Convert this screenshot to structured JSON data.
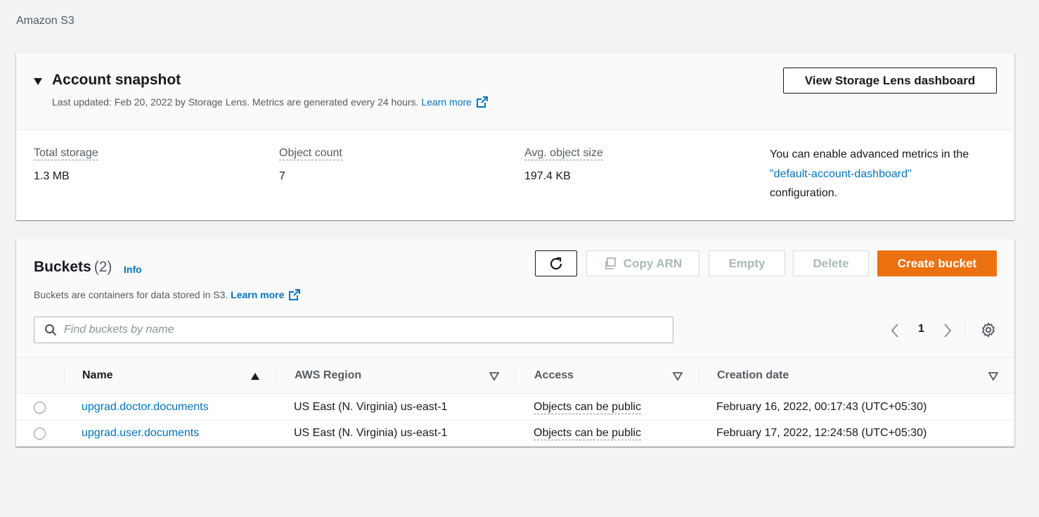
{
  "breadcrumb": "Amazon S3",
  "snapshot": {
    "title": "Account snapshot",
    "subtitle": "Last updated: Feb 20, 2022 by Storage Lens. Metrics are generated every 24 hours.",
    "learn_more": "Learn more",
    "view_button": "View Storage Lens dashboard",
    "metrics": [
      {
        "label": "Total storage",
        "value": "1.3 MB"
      },
      {
        "label": "Object count",
        "value": "7"
      },
      {
        "label": "Avg. object size",
        "value": "197.4 KB"
      }
    ],
    "advanced_text_1": "You can enable advanced metrics in the",
    "advanced_link": "\"default-account-dashboard\"",
    "advanced_text_2": "configuration."
  },
  "buckets": {
    "title": "Buckets",
    "count": "(2)",
    "info": "Info",
    "subtitle": "Buckets are containers for data stored in S3.",
    "learn_more": "Learn more",
    "buttons": {
      "copy_arn": "Copy ARN",
      "empty": "Empty",
      "delete": "Delete",
      "create": "Create bucket"
    },
    "search_placeholder": "Find buckets by name",
    "page": "1",
    "columns": [
      "Name",
      "AWS Region",
      "Access",
      "Creation date"
    ],
    "rows": [
      {
        "name": "upgrad.doctor.documents",
        "region": "US East (N. Virginia) us-east-1",
        "access": "Objects can be public",
        "created": "February 16, 2022, 00:17:43 (UTC+05:30)"
      },
      {
        "name": "upgrad.user.documents",
        "region": "US East (N. Virginia) us-east-1",
        "access": "Objects can be public",
        "created": "February 17, 2022, 12:24:58 (UTC+05:30)"
      }
    ]
  },
  "colors": {
    "accent": "#ec7211",
    "link": "#0073bb",
    "text": "#16191f",
    "muted": "#545b64",
    "background": "#f2f3f3"
  }
}
